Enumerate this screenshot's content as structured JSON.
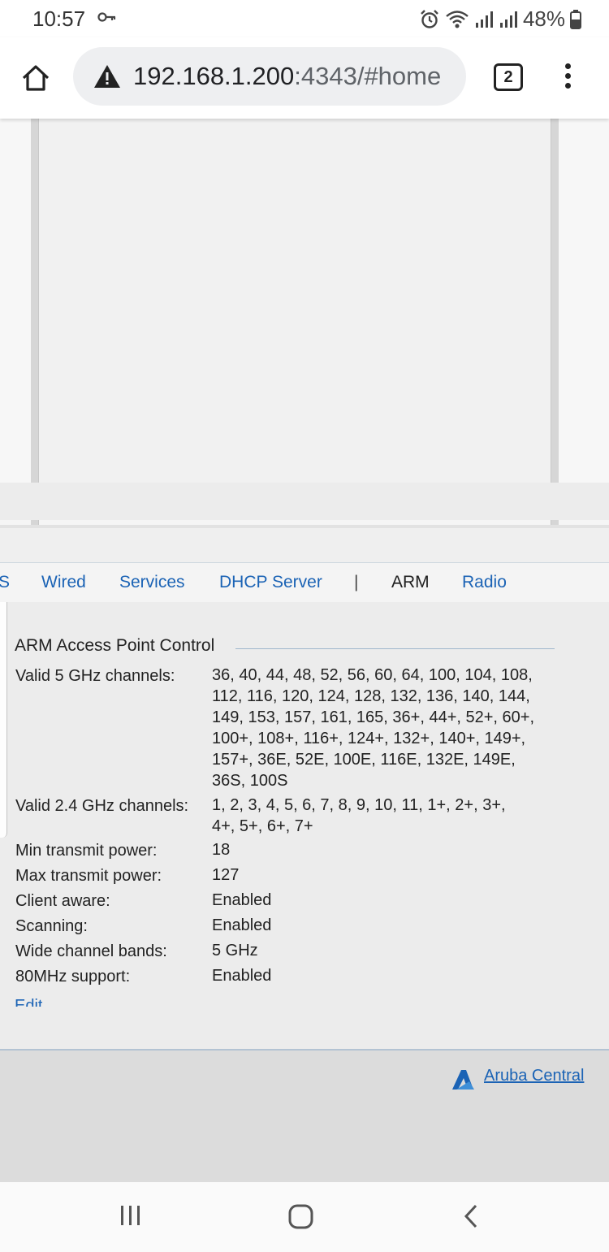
{
  "status_bar": {
    "time": "10:57",
    "battery": "48%",
    "icons": [
      "vpn-key-icon",
      "alarm-icon",
      "wifi-icon",
      "signal-icon",
      "signal-icon",
      "battery-icon"
    ]
  },
  "browser": {
    "url_host": "192.168.1.200",
    "url_rest": ":4343/#home",
    "tab_count": "2"
  },
  "tabs": [
    {
      "label": "S"
    },
    {
      "label": "Wired"
    },
    {
      "label": "Services"
    },
    {
      "label": "DHCP Server"
    },
    {
      "label": "|"
    },
    {
      "label": "ARM"
    },
    {
      "label": "Radio"
    }
  ],
  "section": {
    "title": "ARM Access Point Control"
  },
  "properties": [
    {
      "label": "Valid 5 GHz channels:",
      "value": "36, 40, 44, 48, 52, 56, 60, 64, 100, 104, 108, 112, 116, 120, 124, 128, 132, 136, 140, 144, 149, 153, 157, 161, 165, 36+, 44+, 52+, 60+, 100+, 108+, 116+, 124+, 132+, 140+, 149+, 157+, 36E, 52E, 100E, 116E, 132E, 149E, 36S, 100S"
    },
    {
      "label": "Valid 2.4 GHz channels:",
      "value": "1, 2, 3, 4, 5, 6, 7, 8, 9, 10, 11, 1+, 2+, 3+, 4+, 5+, 6+, 7+"
    },
    {
      "label": "Min transmit power:",
      "value": "18"
    },
    {
      "label": "Max transmit power:",
      "value": "127"
    },
    {
      "label": "Client aware:",
      "value": "Enabled"
    },
    {
      "label": "Scanning:",
      "value": "Enabled"
    },
    {
      "label": "Wide channel bands:",
      "value": "5 GHz"
    },
    {
      "label": "80MHz support:",
      "value": "Enabled"
    }
  ],
  "edit_label": "Edit",
  "footer": {
    "link": "Aruba Central"
  },
  "colors": {
    "link": "#1b63b5",
    "footer_bg": "#dcdcdc",
    "panel_bg": "#ececec"
  }
}
